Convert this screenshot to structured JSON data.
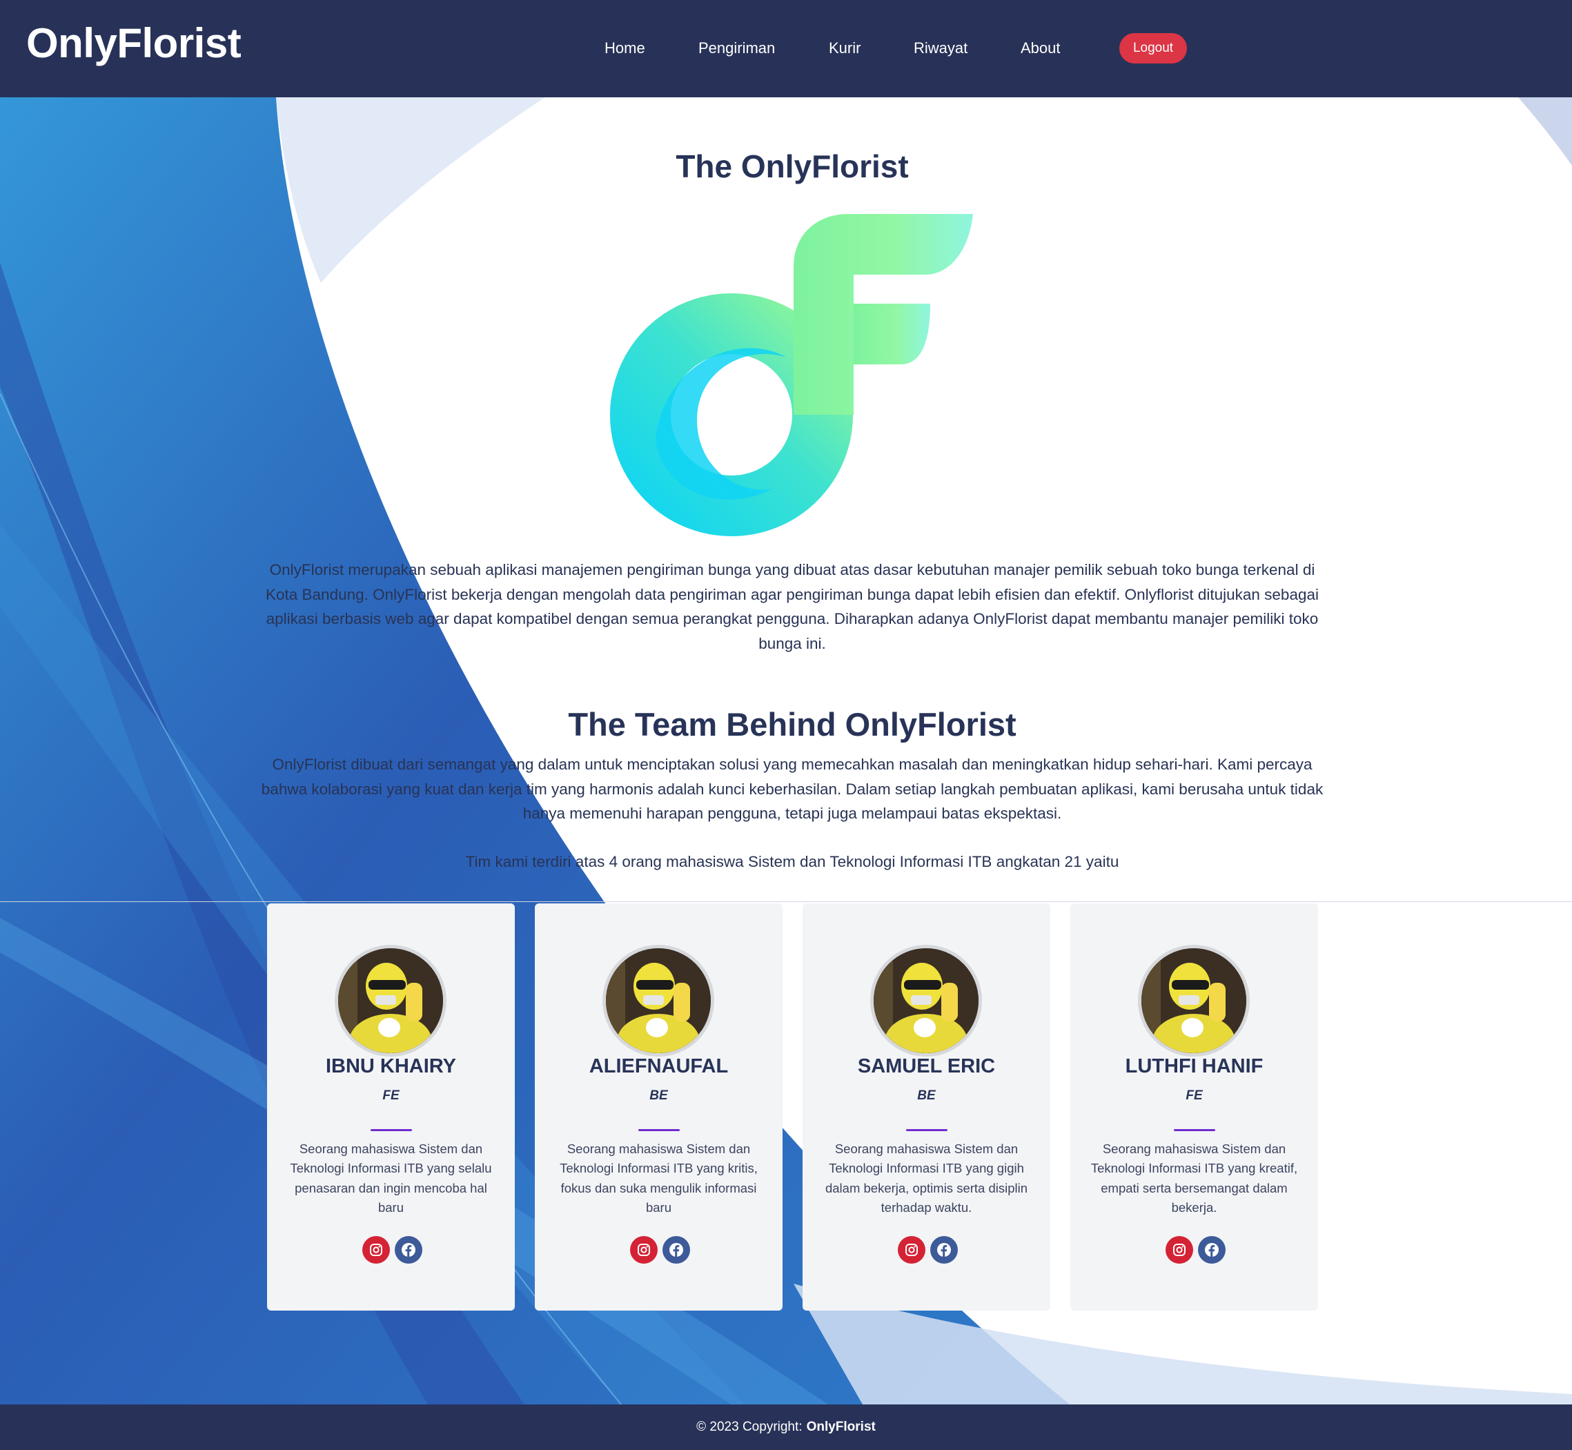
{
  "navbar": {
    "brand": "OnlyFlorist",
    "links": [
      "Home",
      "Pengiriman",
      "Kurir",
      "Riwayat",
      "About"
    ],
    "logout": "Logout"
  },
  "about": {
    "title": "The OnlyFlorist",
    "logo_icon": "onlyflorist-logo-icon",
    "description": "OnlyFlorist merupakan sebuah aplikasi manajemen pengiriman bunga yang dibuat atas dasar kebutuhan manajer pemilik sebuah toko bunga terkenal di Kota Bandung. OnlyFlorist bekerja dengan mengolah data pengiriman agar pengiriman bunga dapat lebih efisien dan efektif. Onlyflorist ditujukan sebagai aplikasi berbasis web agar dapat kompatibel dengan semua perangkat pengguna. Diharapkan adanya OnlyFlorist dapat membantu manajer pemiliki toko bunga ini."
  },
  "team": {
    "title": "The Team Behind OnlyFlorist",
    "intro": "OnlyFlorist dibuat dari semangat yang dalam untuk menciptakan solusi yang memecahkan masalah dan meningkatkan hidup sehari-hari. Kami percaya bahwa kolaborasi yang kuat dan kerja tim yang harmonis adalah kunci keberhasilan. Dalam setiap langkah pembuatan aplikasi, kami berusaha untuk tidak hanya memenuhi harapan pengguna, tetapi juga melampaui batas ekspektasi.",
    "summary": "Tim kami terdiri atas 4 orang mahasiswa Sistem dan Teknologi Informasi ITB angkatan 21 yaitu",
    "members": [
      {
        "name": "IBNU KHAIRY",
        "role": "FE",
        "desc": "Seorang mahasiswa Sistem dan Teknologi Informasi ITB yang selalu penasaran dan ingin mencoba hal baru"
      },
      {
        "name": "ALIEFNAUFAL",
        "role": "BE",
        "desc": "Seorang mahasiswa Sistem dan Teknologi Informasi ITB yang kritis, fokus dan suka mengulik informasi baru"
      },
      {
        "name": "SAMUEL ERIC",
        "role": "BE",
        "desc": "Seorang mahasiswa Sistem dan Teknologi Informasi ITB yang gigih dalam bekerja, optimis serta disiplin terhadap waktu."
      },
      {
        "name": "LUTHFI HANIF",
        "role": "FE",
        "desc": "Seorang mahasiswa Sistem dan Teknologi Informasi ITB yang kreatif, empati serta bersemangat dalam bekerja."
      }
    ]
  },
  "footer": {
    "prefix": "© 2023 Copyright:",
    "brand": "OnlyFlorist"
  },
  "colors": {
    "navbar": "#283258",
    "logout": "#dc3545",
    "instagram": "#d42335",
    "facebook": "#3d5a99",
    "accent_line": "#6f2bd0"
  }
}
